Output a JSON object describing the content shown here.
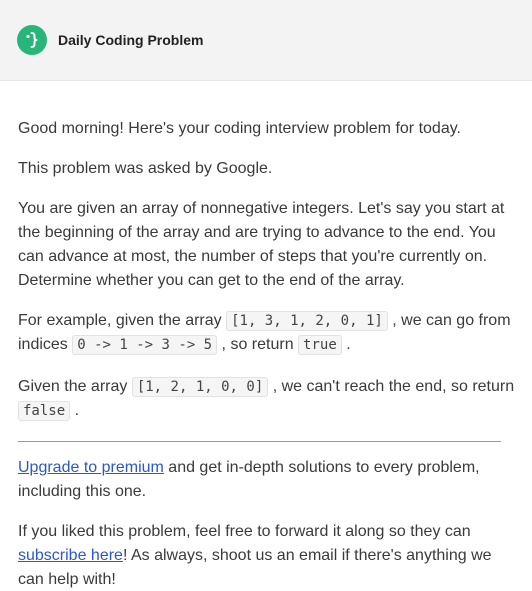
{
  "header": {
    "logo_icon": "curly-brace-logo-icon",
    "brand_color": "#27b57a",
    "title": "Daily Coding Problem"
  },
  "body": {
    "greeting": "Good morning! Here's your coding interview problem for today.",
    "asked_by": "This problem was asked by Google.",
    "problem": "You are given an array of nonnegative integers. Let's say you start at the beginning of the array and are trying to advance to the end. You can advance at most, the number of steps that you're currently on. Determine whether you can get to the end of the array.",
    "example1": {
      "prefix": "For example, given the array ",
      "array": "[1, 3, 1, 2, 0, 1]",
      "middle": " , we can go from indices ",
      "path": "0 -> 1 -> 3 -> 5",
      "middle2": " , so return ",
      "result": "true",
      "suffix": " ."
    },
    "example2": {
      "prefix": "Given the array ",
      "array": "[1, 2, 1, 0, 0]",
      "middle": " , we can't reach the end, so return ",
      "result": "false",
      "suffix": " ."
    },
    "premium": {
      "link": "Upgrade to premium",
      "text": " and get in-depth solutions to every problem, including this one."
    },
    "closing": {
      "prefix": "If you liked this problem, feel free to forward it along so they can ",
      "link": "subscribe here",
      "suffix": "! As always, shoot us an email if there's anything we can help with!"
    },
    "link_color": "#2b58c9"
  }
}
